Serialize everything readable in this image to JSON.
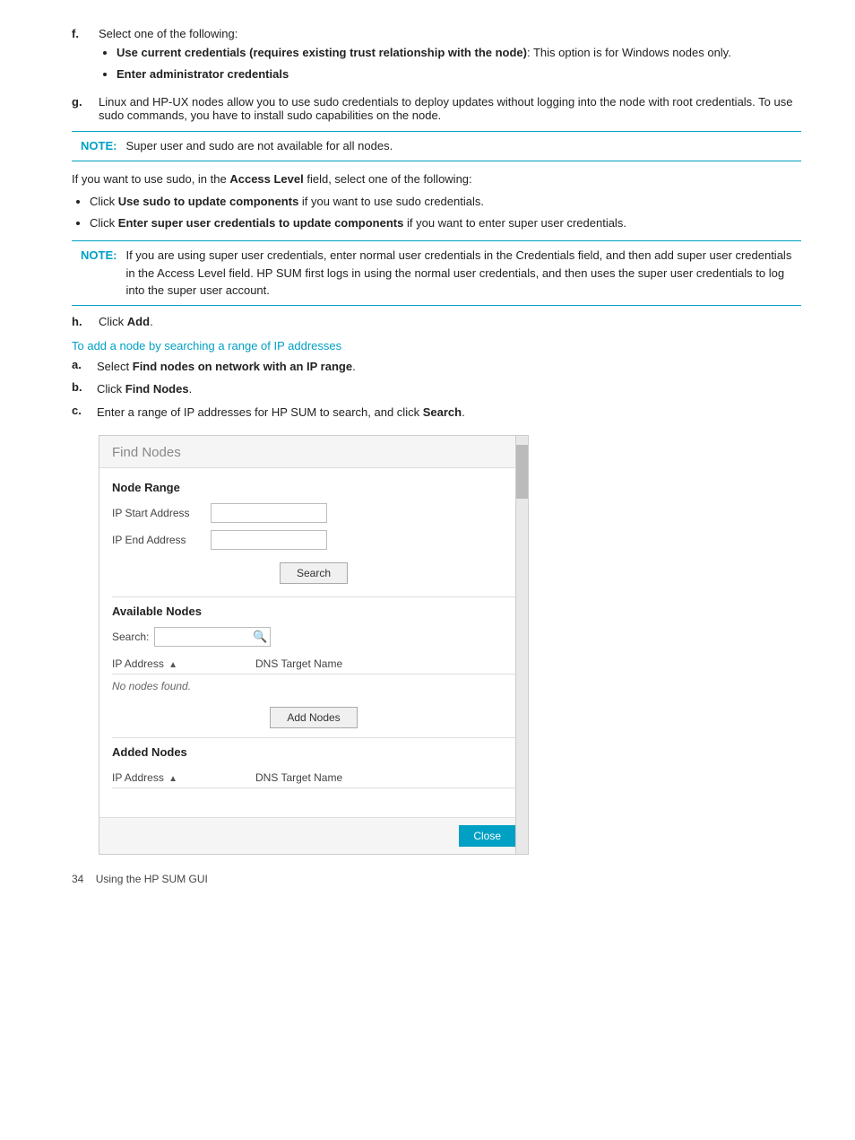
{
  "steps": {
    "f": {
      "label": "f.",
      "intro": "Select one of the following:",
      "bullets": [
        {
          "bold_part": "Use current credentials (requires existing trust relationship with the node)",
          "rest": ": This option is for Windows nodes only."
        },
        {
          "bold_part": "Enter administrator credentials",
          "rest": ""
        }
      ]
    },
    "g": {
      "label": "g.",
      "text": "Linux and HP-UX nodes allow you to use sudo credentials to deploy updates without logging into the node with root credentials. To use sudo commands, you have to install sudo capabilities on the node."
    },
    "note1": {
      "label": "NOTE:",
      "text": "Super user and sudo are not available for all nodes."
    },
    "access_level_intro": "If you want to use sudo, in the ",
    "access_level_bold": "Access Level",
    "access_level_end": " field, select one of the following:",
    "access_bullets": [
      {
        "text": "Click ",
        "bold": "Use sudo to update components",
        "rest": " if you want to use sudo credentials."
      },
      {
        "text": "Click ",
        "bold": "Enter super user credentials to update components",
        "rest": " if you want to enter super user credentials."
      }
    ],
    "note2": {
      "label": "NOTE:",
      "text": "If you are using super user credentials, enter normal user credentials in the Credentials field, and then add super user credentials in the Access Level field. HP SUM first logs in using the normal user credentials, and then uses the super user credentials to log into the super user account."
    },
    "h": {
      "label": "h.",
      "text": "Click ",
      "bold": "Add",
      "end": "."
    }
  },
  "section_heading": "To add a node by searching a range of IP addresses",
  "sub_steps": [
    {
      "label": "a.",
      "text": "Select ",
      "bold": "Find nodes on network with an IP range",
      "end": "."
    },
    {
      "label": "b.",
      "text": "Click ",
      "bold": "Find Nodes",
      "end": "."
    },
    {
      "label": "c.",
      "text": "Enter a range of IP addresses for HP SUM to search, and click ",
      "bold": "Search",
      "end": "."
    }
  ],
  "dialog": {
    "title": "Find Nodes",
    "node_range_label": "Node Range",
    "ip_start_label": "IP Start Address",
    "ip_end_label": "IP End Address",
    "search_button": "Search",
    "available_nodes_label": "Available Nodes",
    "search_label": "Search:",
    "search_placeholder": "",
    "ip_address_col": "IP Address",
    "dns_col": "DNS Target Name",
    "no_nodes_text": "No nodes found.",
    "add_nodes_button": "Add Nodes",
    "added_nodes_label": "Added Nodes",
    "added_ip_col": "IP Address",
    "added_dns_col": "DNS Target Name",
    "close_button": "Close"
  },
  "footer": {
    "page_number": "34",
    "text": "Using the HP SUM GUI"
  }
}
